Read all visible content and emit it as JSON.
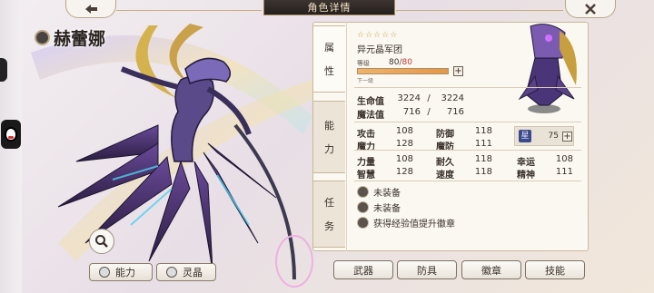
{
  "header": {
    "title": "角色详情"
  },
  "character": {
    "name": "赫蕾娜"
  },
  "tabs": [
    {
      "label_top": "属",
      "label_bottom": "性"
    },
    {
      "label_top": "能",
      "label_bottom": "力"
    },
    {
      "label_top": "任",
      "label_bottom": "务"
    }
  ],
  "attributes": {
    "stars": "☆☆☆☆☆",
    "guild": "异元晶军团",
    "level_label": "等级",
    "level_current": "80",
    "level_max": "80",
    "level_progress": 1.0,
    "next_label": "下一级",
    "hp_label": "生命值",
    "hp_current": "3224",
    "hp_max": "3224",
    "mp_label": "魔法值",
    "mp_current": "716",
    "mp_max": "716"
  },
  "stats": {
    "rows": [
      [
        {
          "label": "攻击",
          "value": "108"
        },
        {
          "label": "防御",
          "value": "118"
        }
      ],
      [
        {
          "label": "魔力",
          "value": "128"
        },
        {
          "label": "魔防",
          "value": "111"
        }
      ],
      [
        {
          "label": "力量",
          "value": "108"
        },
        {
          "label": "耐久",
          "value": "118"
        },
        {
          "label": "幸运",
          "value": "108"
        }
      ],
      [
        {
          "label": "智慧",
          "value": "128"
        },
        {
          "label": "速度",
          "value": "118"
        },
        {
          "label": "精神",
          "value": "111"
        }
      ]
    ],
    "rank_badge": "星",
    "rank_value": "75"
  },
  "equipment": {
    "slot1": "未装备",
    "slot2": "未装备",
    "hint": "获得经验值提升徽章"
  },
  "bottom_buttons": {
    "weapon": "武器",
    "armor": "防具",
    "badge": "徽章",
    "skill": "技能"
  },
  "left_buttons": {
    "ability": "能力",
    "crystal": "灵晶"
  },
  "colors": {
    "accent_gold": "#c7ae7d",
    "level_bar": "#e59646",
    "panel_bg": "#fbf8f2",
    "max_red": "#c33a2a"
  }
}
